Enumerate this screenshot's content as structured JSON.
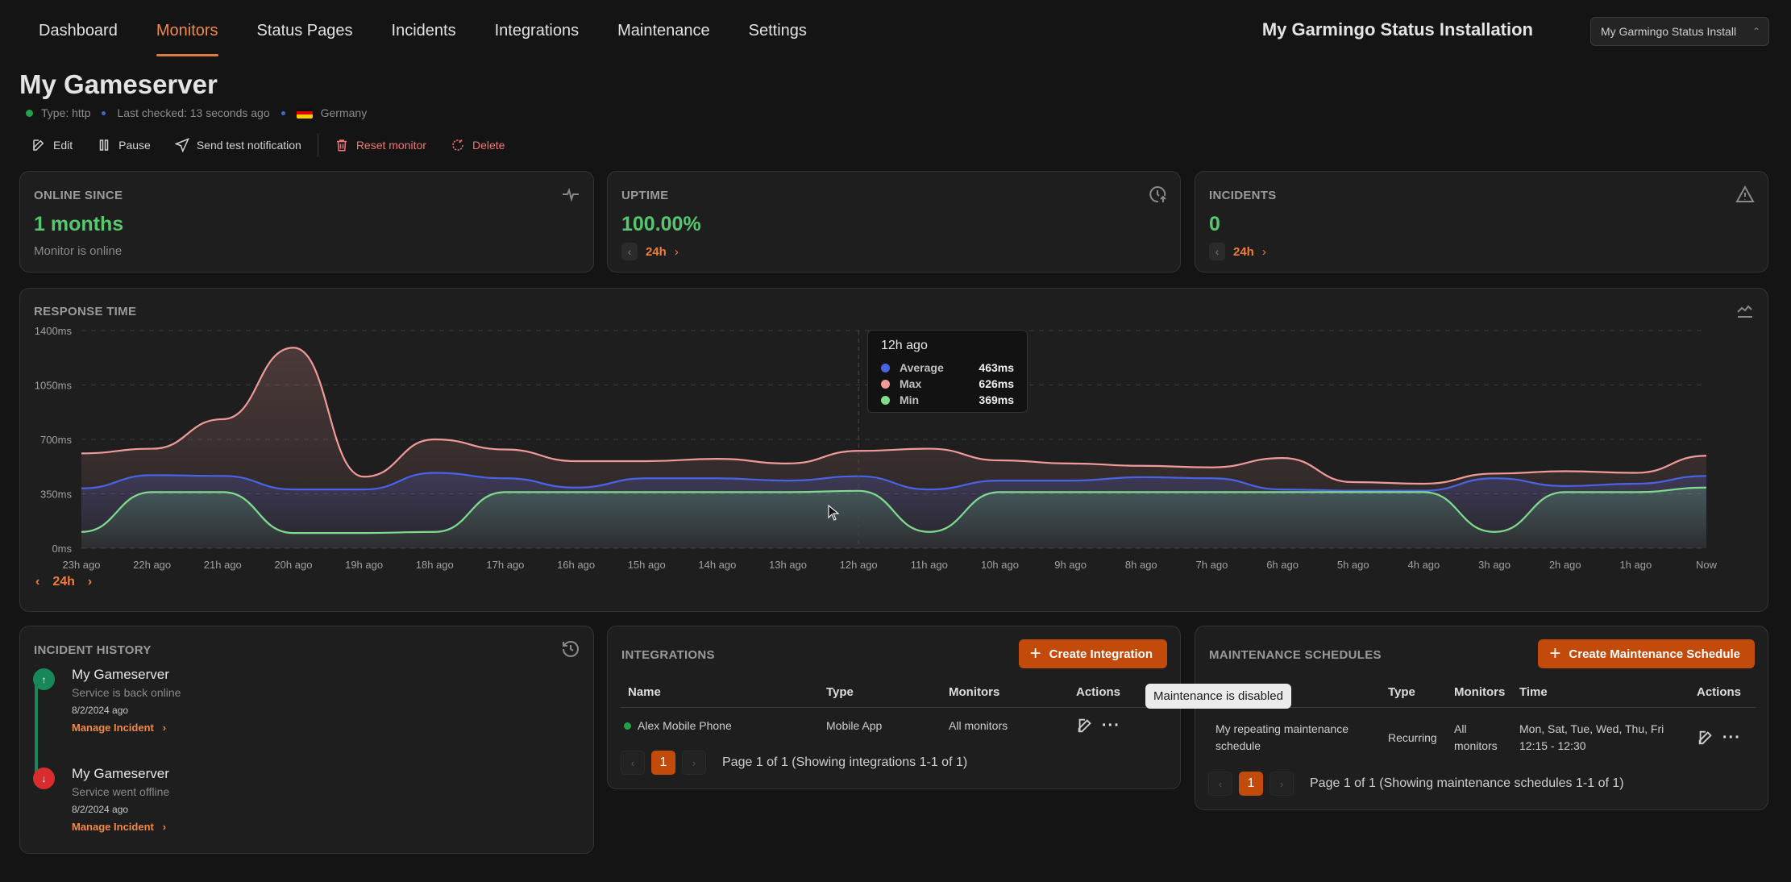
{
  "nav": {
    "items": [
      "Dashboard",
      "Monitors",
      "Status Pages",
      "Incidents",
      "Integrations",
      "Maintenance",
      "Settings"
    ],
    "active": "Monitors",
    "installation_title": "My Garmingo Status Installation",
    "installation_select": "My Garmingo Status Install"
  },
  "monitor": {
    "title": "My Gameserver",
    "type": "Type: http",
    "last_checked": "Last checked: 13 seconds ago",
    "location": "Germany",
    "status_color": "#22a04a"
  },
  "actions": {
    "edit": "Edit",
    "pause": "Pause",
    "send_test": "Send test notification",
    "reset": "Reset monitor",
    "delete": "Delete"
  },
  "stats": {
    "online_since": {
      "label": "ONLINE SINCE",
      "value": "1 months",
      "sub": "Monitor is online",
      "icon": "activity-icon"
    },
    "uptime": {
      "label": "UPTIME",
      "value": "100.00%",
      "range": "24h",
      "icon": "clock-up-icon"
    },
    "incidents": {
      "label": "INCIDENTS",
      "value": "0",
      "range": "24h",
      "icon": "warning-triangle-icon"
    }
  },
  "response_time": {
    "label": "RESPONSE TIME",
    "range": "24h",
    "tooltip": {
      "title": "12h ago",
      "rows": [
        {
          "name": "Average",
          "value": "463ms",
          "color": "#4a63e6"
        },
        {
          "name": "Max",
          "value": "626ms",
          "color": "#f19a9a"
        },
        {
          "name": "Min",
          "value": "369ms",
          "color": "#7fdc8c"
        }
      ]
    }
  },
  "chart_data": {
    "type": "area",
    "title": "RESPONSE TIME",
    "xlabel": "",
    "ylabel": "",
    "x": [
      "23h ago",
      "22h ago",
      "21h ago",
      "20h ago",
      "19h ago",
      "18h ago",
      "17h ago",
      "16h ago",
      "15h ago",
      "14h ago",
      "13h ago",
      "12h ago",
      "11h ago",
      "10h ago",
      "9h ago",
      "8h ago",
      "7h ago",
      "6h ago",
      "5h ago",
      "4h ago",
      "3h ago",
      "2h ago",
      "1h ago",
      "Now"
    ],
    "y_ticks": [
      "0ms",
      "350ms",
      "700ms",
      "1050ms",
      "1400ms"
    ],
    "ylim": [
      0,
      1400
    ],
    "grid": true,
    "highlight_index": 11,
    "series": [
      {
        "name": "Max",
        "color": "#f19a9a",
        "values": [
          610,
          640,
          830,
          1290,
          460,
          700,
          635,
          560,
          560,
          575,
          545,
          626,
          640,
          565,
          545,
          530,
          520,
          580,
          425,
          415,
          480,
          495,
          485,
          595
        ]
      },
      {
        "name": "Average",
        "color": "#4a63e6",
        "values": [
          385,
          470,
          465,
          378,
          378,
          485,
          450,
          390,
          450,
          450,
          435,
          463,
          378,
          435,
          435,
          457,
          450,
          378,
          370,
          370,
          450,
          400,
          415,
          465
        ]
      },
      {
        "name": "Min",
        "color": "#7fdc8c",
        "values": [
          105,
          361,
          361,
          98,
          98,
          105,
          361,
          361,
          361,
          361,
          361,
          369,
          105,
          361,
          361,
          361,
          361,
          361,
          361,
          361,
          105,
          361,
          361,
          390
        ]
      }
    ]
  },
  "incident_history": {
    "label": "INCIDENT HISTORY",
    "items": [
      {
        "name": "My Gameserver",
        "desc": "Service is back online",
        "date": "8/2/2024 ago",
        "link": "Manage Incident",
        "state": "up",
        "color": "#16885a"
      },
      {
        "name": "My Gameserver",
        "desc": "Service went offline",
        "date": "8/2/2024 ago",
        "link": "Manage Incident",
        "state": "down",
        "color": "#d92d2d"
      }
    ]
  },
  "integrations": {
    "label": "INTEGRATIONS",
    "create_label": "Create Integration",
    "columns": [
      "Name",
      "Type",
      "Monitors",
      "Actions"
    ],
    "rows": [
      {
        "name": "Alex Mobile Phone",
        "type": "Mobile App",
        "monitors": "All monitors"
      }
    ],
    "page": "1",
    "page_text": "Page 1 of 1 (Showing integrations 1-1 of 1)"
  },
  "maintenance": {
    "label": "MAINTENANCE SCHEDULES",
    "create_label": "Create Maintenance Schedule",
    "columns": [
      "Name",
      "Type",
      "Monitors",
      "Time",
      "Actions"
    ],
    "rows": [
      {
        "name": "My repeating maintenance schedule",
        "type": "Recurring",
        "monitors": "All monitors",
        "days": "Mon, Sat, Tue, Wed, Thu, Fri",
        "time": "12:15 - 12:30"
      }
    ],
    "page": "1",
    "page_text": "Page 1 of 1 (Showing maintenance schedules 1-1 of 1)",
    "hover_tooltip": "Maintenance is disabled"
  },
  "colors": {
    "accent": "#f07d3a",
    "primary_button": "#c24a0b",
    "success": "#57c76f",
    "danger": "#f07474"
  }
}
